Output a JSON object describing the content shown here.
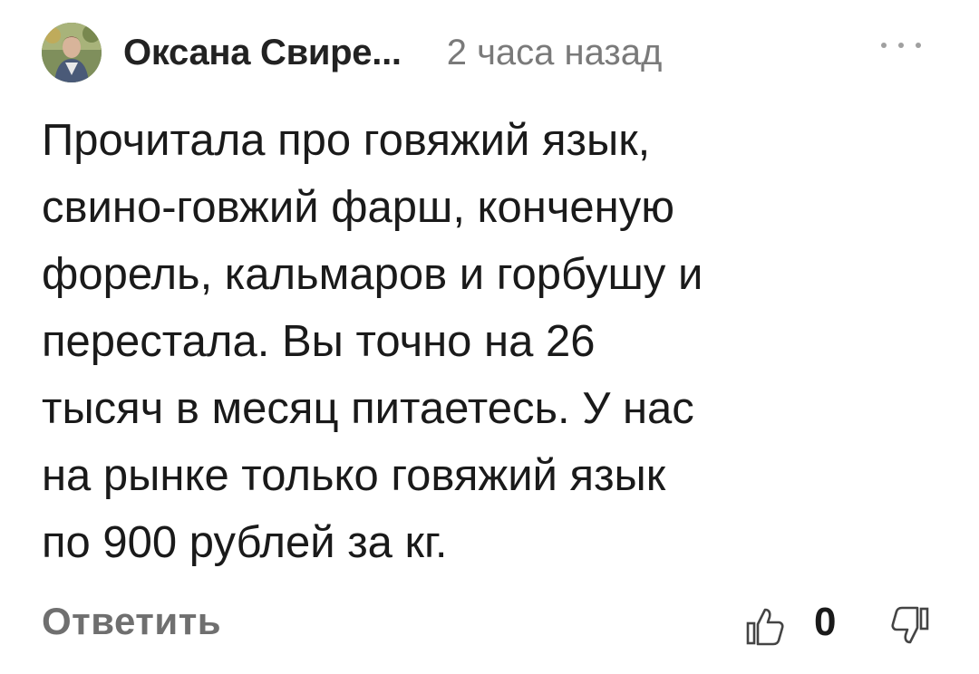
{
  "comment": {
    "author": "Оксана Свире...",
    "time": "2 часа назад",
    "text_lines": [
      "Прочитала про говяжий язык,",
      "свино-говжий фарш, конченую",
      "форель, кальмаров и горбушу и",
      "перестала. Вы точно на 26",
      "тысяч в месяц питаетесь. У нас",
      "на рынке только говяжий язык",
      "по 900 рублей за кг."
    ],
    "reply_label": "Ответить",
    "score": "0"
  },
  "icons": {
    "more": "more-dots-icon",
    "like": "thumb-up-icon",
    "dislike": "thumb-down-icon"
  },
  "colors": {
    "text": "#1a1a1a",
    "muted": "#7a7a7a",
    "reply": "#6f6f6f"
  }
}
